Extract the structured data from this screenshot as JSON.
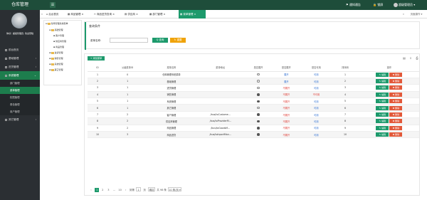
{
  "app": {
    "title": "仓库管理",
    "menu_toggle": "☰",
    "header_right": {
      "notice": "⚑ 通知通告",
      "lock": "🔒 锁屏",
      "user": "超级管理员 ▾"
    }
  },
  "sidebar": {
    "welcome": "你好！超级管理员, 欢迎登陆",
    "items": [
      {
        "label": "前台首页",
        "chev": ""
      },
      {
        "label": "基础管理",
        "chev": "‹"
      },
      {
        "label": "进货管理",
        "chev": "‹"
      },
      {
        "label": "系统管理",
        "chev": "⌄"
      }
    ],
    "sub_items": [
      "部门管理",
      "菜单管理",
      "权限管理",
      "角色管理",
      "用户管理"
    ],
    "bottom_items": [
      {
        "label": "其它管理",
        "chev": "‹"
      }
    ]
  },
  "tabs": {
    "prev": "«",
    "next": "»",
    "items": [
      "后台首页",
      "商品管理",
      "商品进货查询",
      "供应商",
      "部门管理",
      "菜单管理"
    ],
    "close": "×",
    "page_ops": "页面操作 ▾"
  },
  "tree": {
    "root": "仓库管理系统菜单",
    "nodes": [
      {
        "label": "基础管理",
        "level": 1
      },
      {
        "label": "客户管理",
        "level": 2
      },
      {
        "label": "供应商管理",
        "level": 2
      },
      {
        "label": "商品管理",
        "level": 2
      },
      {
        "label": "进货管理",
        "level": 1
      },
      {
        "label": "销售管理",
        "level": 1
      },
      {
        "label": "系统管理",
        "level": 1
      },
      {
        "label": "其它管理",
        "level": 1
      }
    ]
  },
  "query": {
    "title": "查询条件",
    "menu_name_label": "菜单名称:",
    "menu_name_value": "",
    "search_label": "Q 查询",
    "reset_label": "↻ 重置"
  },
  "table": {
    "add_label": "+ 添加菜单",
    "tool_icons": [
      "▤",
      "⇩",
      "⎙"
    ],
    "columns": [
      "ID",
      "父级菜单ID",
      "菜单名称",
      "菜单地址",
      "是否展开",
      "是否展开",
      "是否可用",
      "排序码",
      "操作"
    ],
    "edit_label": "✎ 编辑",
    "delete_label": "✖ 删除",
    "rows": [
      {
        "id": "1",
        "pid": "0",
        "name": "仓库管理系统菜单",
        "href": "",
        "radio_on": false,
        "spread": "展开",
        "spread_red": false,
        "avail": "可用",
        "avail_red": false,
        "order": "1"
      },
      {
        "id": "2",
        "pid": "1",
        "name": "基础管理",
        "href": "",
        "radio_on": false,
        "spread": "展开",
        "spread_red": false,
        "avail": "可用",
        "avail_red": false,
        "order": "2"
      },
      {
        "id": "3",
        "pid": "1",
        "name": "进货管理",
        "href": "",
        "radio_on": false,
        "spread": "不展开",
        "spread_red": true,
        "avail": "可用",
        "avail_red": false,
        "order": "3"
      },
      {
        "id": "4",
        "pid": "1",
        "name": "销售管理",
        "href": "",
        "radio_on": true,
        "spread": "不展开",
        "spread_red": true,
        "avail": "不可用",
        "avail_red": true,
        "order": "4"
      },
      {
        "id": "5",
        "pid": "1",
        "name": "系统管理",
        "href": "",
        "radio_on": true,
        "spread": "不展开",
        "spread_red": true,
        "avail": "可用",
        "avail_red": false,
        "order": "5"
      },
      {
        "id": "6",
        "pid": "1",
        "name": "其它管理",
        "href": "",
        "radio_on": false,
        "spread": "不展开",
        "spread_red": true,
        "avail": "可用",
        "avail_red": false,
        "order": "6"
      },
      {
        "id": "7",
        "pid": "2",
        "name": "客户管理",
        "href": "/bus/toCustome...",
        "radio_on": true,
        "spread": "不展开",
        "spread_red": true,
        "avail": "可用",
        "avail_red": false,
        "order": "7"
      },
      {
        "id": "8",
        "pid": "2",
        "name": "供应商管理",
        "href": "/bus/toProviderM...",
        "radio_on": true,
        "spread": "不展开",
        "spread_red": true,
        "avail": "可用",
        "avail_red": false,
        "order": "8"
      },
      {
        "id": "9",
        "pid": "2",
        "name": "商品管理",
        "href": "/bus/toGoodsM...",
        "radio_on": true,
        "spread": "不展开",
        "spread_red": true,
        "avail": "可用",
        "avail_red": false,
        "order": "9"
      },
      {
        "id": "10",
        "pid": "3",
        "name": "商品进货",
        "href": "/bus/toInportMan...",
        "radio_on": true,
        "spread": "不展开",
        "spread_red": true,
        "avail": "可用",
        "avail_red": false,
        "order": "10"
      }
    ]
  },
  "pager": {
    "prev": "‹",
    "pages": [
      "1",
      "2",
      "3"
    ],
    "ellipsis": "...",
    "last": "10",
    "next": "›",
    "goto_label": "到第",
    "goto_value": "1",
    "page_unit": "页",
    "confirm": "确定",
    "total": "共 98 条",
    "page_size": "10 条/页 ▾"
  }
}
